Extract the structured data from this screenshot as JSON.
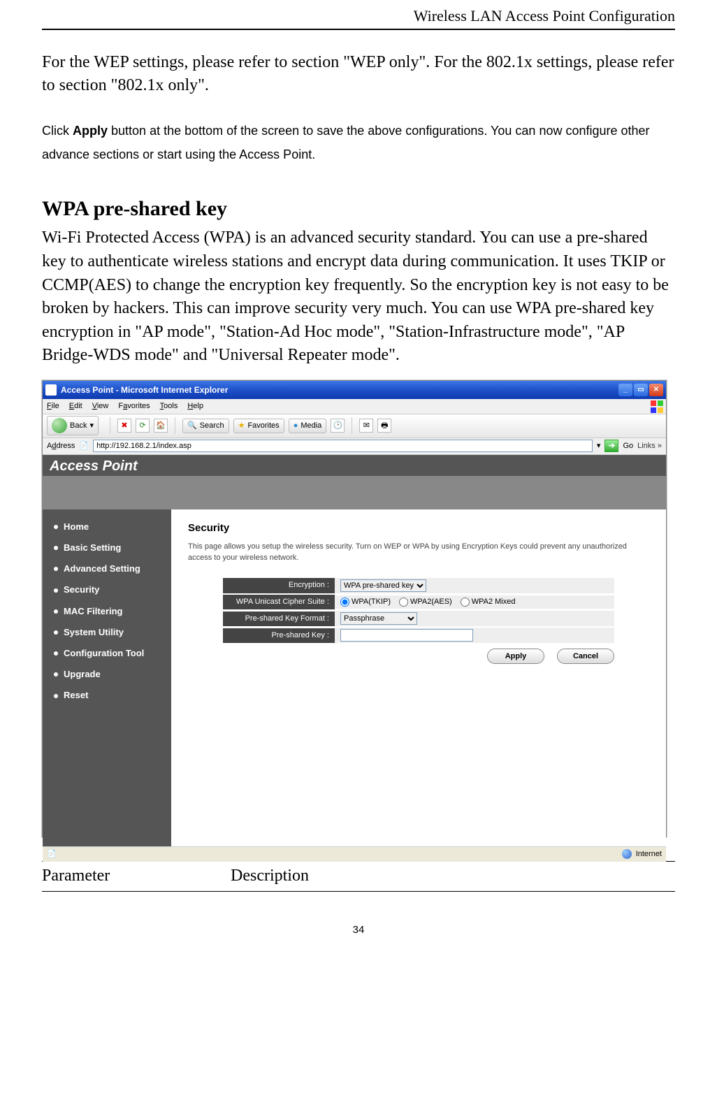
{
  "header": {
    "title": "Wireless LAN Access Point Configuration"
  },
  "main": {
    "intro": "For the WEP settings, please refer to section \"WEP only\". For the 802.1x settings, please refer to section \"802.1x only\".",
    "apply_note_prefix": "Click ",
    "apply_note_bold": "Apply",
    "apply_note_suffix": " button at the bottom of the screen to save the above configurations. You can now configure other advance sections or start using the Access Point.",
    "section_heading": "WPA pre-shared key",
    "body": "Wi-Fi Protected Access (WPA) is an advanced security standard. You can use a pre-shared key to authenticate wireless stations and encrypt data during communication. It uses TKIP or CCMP(AES) to change the encryption key frequently. So the encryption key is not easy to be broken by hackers. This can improve security very much. You can use WPA pre-shared key encryption in \"AP mode\", \"Station-Ad Hoc mode\", \"Station-Infrastructure mode\", \"AP Bridge-WDS mode\" and \"Universal Repeater mode\"."
  },
  "ie": {
    "window_title": "Access Point - Microsoft Internet Explorer",
    "menu": {
      "file": "File",
      "edit": "Edit",
      "view": "View",
      "favorites": "Favorites",
      "tools": "Tools",
      "help": "Help"
    },
    "toolbar": {
      "back": "Back",
      "search": "Search",
      "favorites": "Favorites",
      "media": "Media"
    },
    "addressbar": {
      "label": "Address",
      "url": "http://192.168.2.1/index.asp",
      "go": "Go",
      "links": "Links"
    },
    "statusbar": {
      "done_icon": "📄",
      "zone": "Internet"
    }
  },
  "ap": {
    "banner": "Access Point",
    "sidebar": {
      "items": [
        {
          "label": "Home"
        },
        {
          "label": "Basic Setting"
        },
        {
          "label": "Advanced Setting"
        },
        {
          "label": "Security"
        },
        {
          "label": "MAC Filtering"
        },
        {
          "label": "System Utility"
        },
        {
          "label": "Configuration Tool"
        },
        {
          "label": "Upgrade"
        },
        {
          "label": "Reset"
        }
      ]
    },
    "content": {
      "heading": "Security",
      "desc": "This page allows you setup the wireless security. Turn on WEP or WPA by using Encryption Keys could prevent any unauthorized access to your wireless network.",
      "rows": {
        "encryption": {
          "label": "Encryption :",
          "value": "WPA pre-shared key"
        },
        "cipher": {
          "label": "WPA Unicast Cipher Suite :",
          "options": [
            {
              "label": "WPA(TKIP)",
              "checked": true
            },
            {
              "label": "WPA2(AES)",
              "checked": false
            },
            {
              "label": "WPA2 Mixed",
              "checked": false
            }
          ]
        },
        "format": {
          "label": "Pre-shared Key Format :",
          "value": "Passphrase"
        },
        "key": {
          "label": "Pre-shared Key :",
          "value": ""
        }
      },
      "buttons": {
        "apply": "Apply",
        "cancel": "Cancel"
      }
    }
  },
  "table": {
    "col1": "Parameter",
    "col2": "Description"
  },
  "footer": {
    "page": "34"
  }
}
